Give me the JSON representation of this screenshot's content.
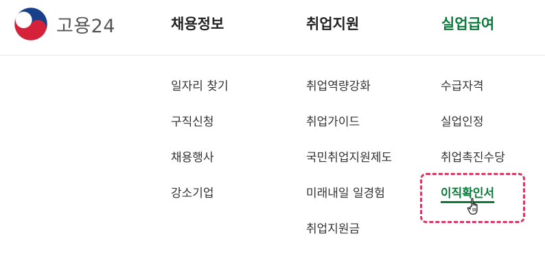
{
  "logo": {
    "text": "고용24"
  },
  "gnb": {
    "items": [
      {
        "label": "채용정보",
        "active": false
      },
      {
        "label": "취업지원",
        "active": false
      },
      {
        "label": "실업급여",
        "active": true
      }
    ]
  },
  "submenu": {
    "columns": [
      {
        "items": [
          "일자리 찾기",
          "구직신청",
          "채용행사",
          "강소기업"
        ]
      },
      {
        "items": [
          "취업역량강화",
          "취업가이드",
          "국민취업지원제도",
          "미래내일 일경험",
          "취업지원금"
        ]
      },
      {
        "items": [
          "수급자격",
          "실업인정",
          "취업촉진수당",
          "이직확인서"
        ]
      }
    ],
    "active_item": "이직확인서"
  },
  "colors": {
    "accent_green": "#0a7a3b",
    "highlight_pink": "#d63864",
    "logo_red": "#d6213b",
    "logo_blue": "#173f8a"
  },
  "icons": {
    "logo": "taegeuk-logo-icon",
    "cursor": "hand-pointer-icon"
  }
}
